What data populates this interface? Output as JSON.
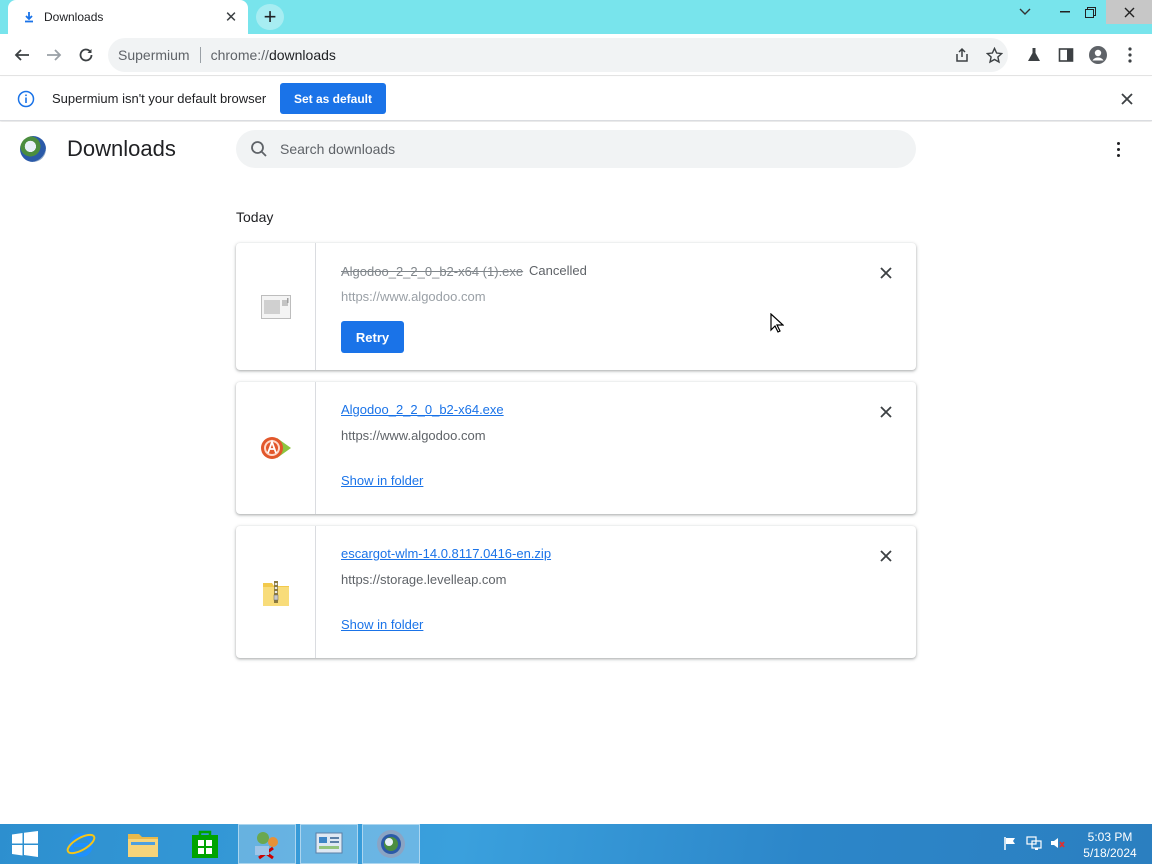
{
  "browser": {
    "tab": {
      "title": "Downloads",
      "icon": "download-icon"
    },
    "omnibox": {
      "site_label": "Supermium",
      "url_prefix": "chrome://",
      "url_host": "downloads"
    }
  },
  "infobar": {
    "message": "Supermium isn't your default browser",
    "button_label": "Set as default"
  },
  "page": {
    "title": "Downloads",
    "search_placeholder": "Search downloads",
    "section_label": "Today"
  },
  "downloads": [
    {
      "file_name": "Algodoo_2_2_0_b2-x64 (1).exe",
      "status": "Cancelled",
      "url": "https://www.algodoo.com",
      "action_label": "Retry",
      "state": "cancelled",
      "icon": "generic-file-icon"
    },
    {
      "file_name": "Algodoo_2_2_0_b2-x64.exe",
      "status": "",
      "url": "https://www.algodoo.com",
      "action_label": "Show in folder",
      "state": "complete",
      "icon": "algodoo-app-icon"
    },
    {
      "file_name": "escargot-wlm-14.0.8117.0416-en.zip",
      "status": "",
      "url": "https://storage.levelleap.com",
      "action_label": "Show in folder",
      "state": "complete",
      "icon": "zip-folder-icon"
    }
  ],
  "taskbar": {
    "items": [
      "start-icon",
      "internet-explorer-icon",
      "file-explorer-icon",
      "store-icon",
      "network-app-icon",
      "control-panel-icon",
      "supermium-icon"
    ],
    "clock": {
      "time": "5:03 PM",
      "date": "5/18/2024"
    }
  },
  "colors": {
    "titlebar": "#78e4ec",
    "accent": "#1a73e8",
    "taskbar": "#2d8fcf"
  }
}
